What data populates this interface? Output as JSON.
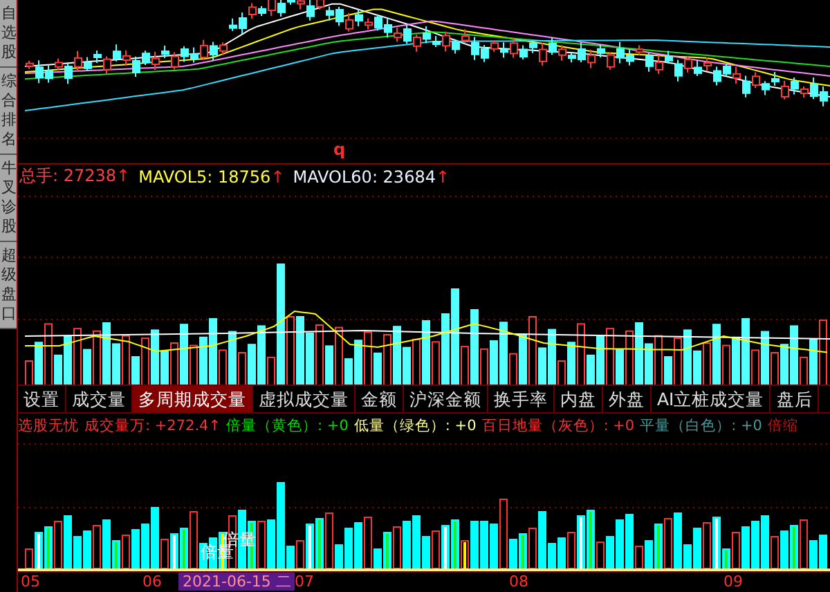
{
  "sidebar": {
    "items": [
      {
        "label": "自选股",
        "selected": false
      },
      {
        "label": "综合排名",
        "selected": false
      },
      {
        "label": "牛叉诊股",
        "selected": false
      },
      {
        "label": "超级盘口",
        "selected": false
      }
    ]
  },
  "price_chart": {
    "marker": "q"
  },
  "volume_panel": {
    "legend": [
      {
        "text": "总手: 27238",
        "arrow": "↑",
        "color": "#ff4040"
      },
      {
        "text": "MAVOL5: 18756",
        "arrow": "↑",
        "color": "#ffff40"
      },
      {
        "text": "MAVOL60: 23684",
        "arrow": "↑",
        "color": "#e8f4ff"
      }
    ]
  },
  "tabs": [
    {
      "label": "设置",
      "selected": false
    },
    {
      "label": "成交量",
      "selected": false
    },
    {
      "label": "多周期成交量",
      "selected": true
    },
    {
      "label": "虚拟成交量",
      "selected": false
    },
    {
      "label": "金额",
      "selected": false
    },
    {
      "label": "沪深金额",
      "selected": false
    },
    {
      "label": "换手率",
      "selected": false
    },
    {
      "label": "内盘",
      "selected": false
    },
    {
      "label": "外盘",
      "selected": false
    },
    {
      "label": "AI立桩成交量",
      "selected": false
    },
    {
      "label": "盘后",
      "selected": false
    }
  ],
  "indicator_panel": {
    "legend": [
      {
        "text": "选股无忧",
        "color": "#ff3030"
      },
      {
        "text": "成交量万: +272.4↑",
        "color": "#ff3030"
      },
      {
        "text": "倍量（黄色）: +0",
        "color": "#00e000"
      },
      {
        "text": "低量（绿色）: +0",
        "color": "#ffff99"
      },
      {
        "text": "百日地量（灰色）: +0",
        "color": "#ff3030"
      },
      {
        "text": "平量（白色）: +0",
        "color": "#4a9a9a"
      },
      {
        "text": "倍缩",
        "color": "#cc1010"
      }
    ],
    "annotations": [
      "倍量",
      "倍量"
    ]
  },
  "date_axis": [
    {
      "label": "05",
      "kind": "tick"
    },
    {
      "label": "06",
      "kind": "tick"
    },
    {
      "label": "2021-06-15 二",
      "kind": "cursor"
    },
    {
      "label": "07",
      "kind": "tick"
    },
    {
      "label": "08",
      "kind": "tick"
    },
    {
      "label": "09",
      "kind": "tick"
    }
  ]
}
